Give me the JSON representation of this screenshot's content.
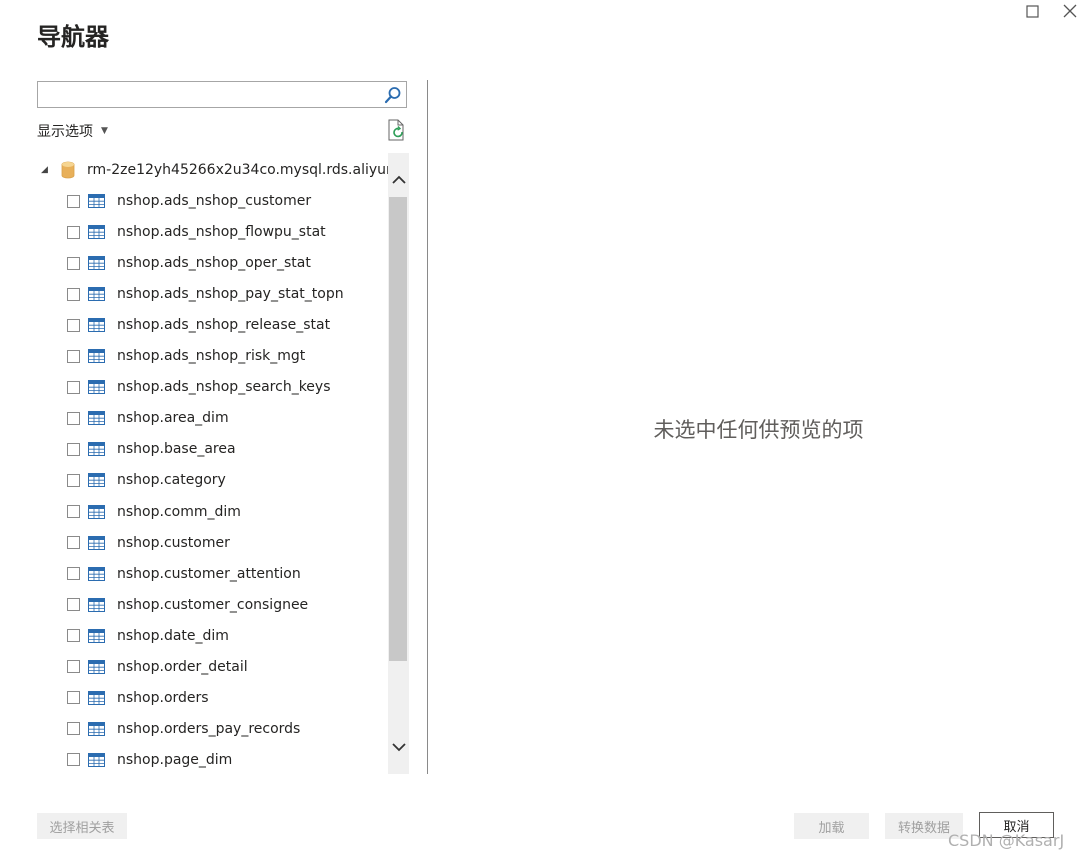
{
  "window": {
    "title": "导航器"
  },
  "search": {
    "value": "",
    "placeholder": ""
  },
  "display_options": {
    "label": "显示选项",
    "caret": "▼"
  },
  "tree": {
    "root": {
      "label": "rm-2ze12yh45266x2u34co.mysql.rds.aliyun...",
      "expander": "◢"
    },
    "items": [
      "nshop.ads_nshop_customer",
      "nshop.ads_nshop_flowpu_stat",
      "nshop.ads_nshop_oper_stat",
      "nshop.ads_nshop_pay_stat_topn",
      "nshop.ads_nshop_release_stat",
      "nshop.ads_nshop_risk_mgt",
      "nshop.ads_nshop_search_keys",
      "nshop.area_dim",
      "nshop.base_area",
      "nshop.category",
      "nshop.comm_dim",
      "nshop.customer",
      "nshop.customer_attention",
      "nshop.customer_consignee",
      "nshop.date_dim",
      "nshop.order_detail",
      "nshop.orders",
      "nshop.orders_pay_records",
      "nshop.page_dim"
    ]
  },
  "preview": {
    "empty_message": "未选中任何供预览的项"
  },
  "buttons": {
    "select_related": "选择相关表",
    "load": "加载",
    "transform": "转换数据",
    "cancel": "取消"
  },
  "watermark": "CSDN @KasarJ",
  "colors": {
    "table_icon": "#2b6cb0",
    "db_icon": "#e8b05a",
    "accent_refresh": "#2e9e58"
  }
}
